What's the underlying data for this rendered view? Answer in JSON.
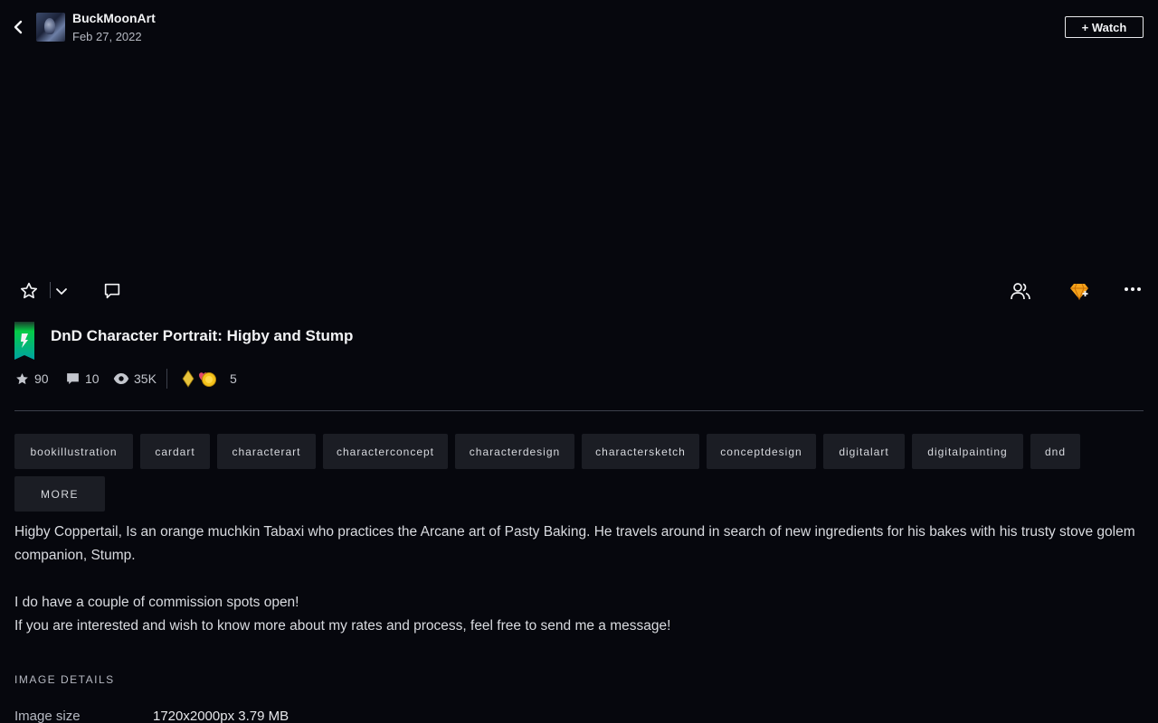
{
  "header": {
    "author_name": "BuckMoonArt",
    "date": "Feb 27, 2022",
    "watch_label": "+ Watch"
  },
  "icons": {
    "back": "chevron-left-icon",
    "favorite": "star-outline-icon",
    "favorite_menu": "chevron-down-icon",
    "comment": "comment-icon",
    "groups": "users-icon",
    "give": "gem-icon",
    "more": "ellipsis-icon",
    "badge": "deviantart-ribbon-icon"
  },
  "colors": {
    "background": "#06070d",
    "accent_green": "#05cc47",
    "gem_orange": "#f6a31b",
    "tag_bg": "#1b1d24"
  },
  "deviation": {
    "title": "DnD Character Portrait: Higby and Stump",
    "stats": {
      "favorites": "90",
      "comments": "10",
      "views": "35K",
      "awards": "5"
    }
  },
  "tags": [
    "bookillustration",
    "cardart",
    "characterart",
    "characterconcept",
    "characterdesign",
    "charactersketch",
    "conceptdesign",
    "digitalart",
    "digitalpainting",
    "dnd"
  ],
  "more_label": "MORE",
  "description": {
    "p1": "Higby Coppertail, Is an orange muchkin Tabaxi who practices the Arcane art of Pasty Baking. He travels around in search of new ingredients for his bakes with his trusty stove golem companion, Stump.",
    "p2": "I do have a couple of commission spots open!",
    "p3": "If you are interested and wish to know more about my rates and process, feel free to send me a message!"
  },
  "details": {
    "section_title": "IMAGE DETAILS",
    "image_size_label": "Image size",
    "image_size_value": "1720x2000px 3.79 MB"
  }
}
